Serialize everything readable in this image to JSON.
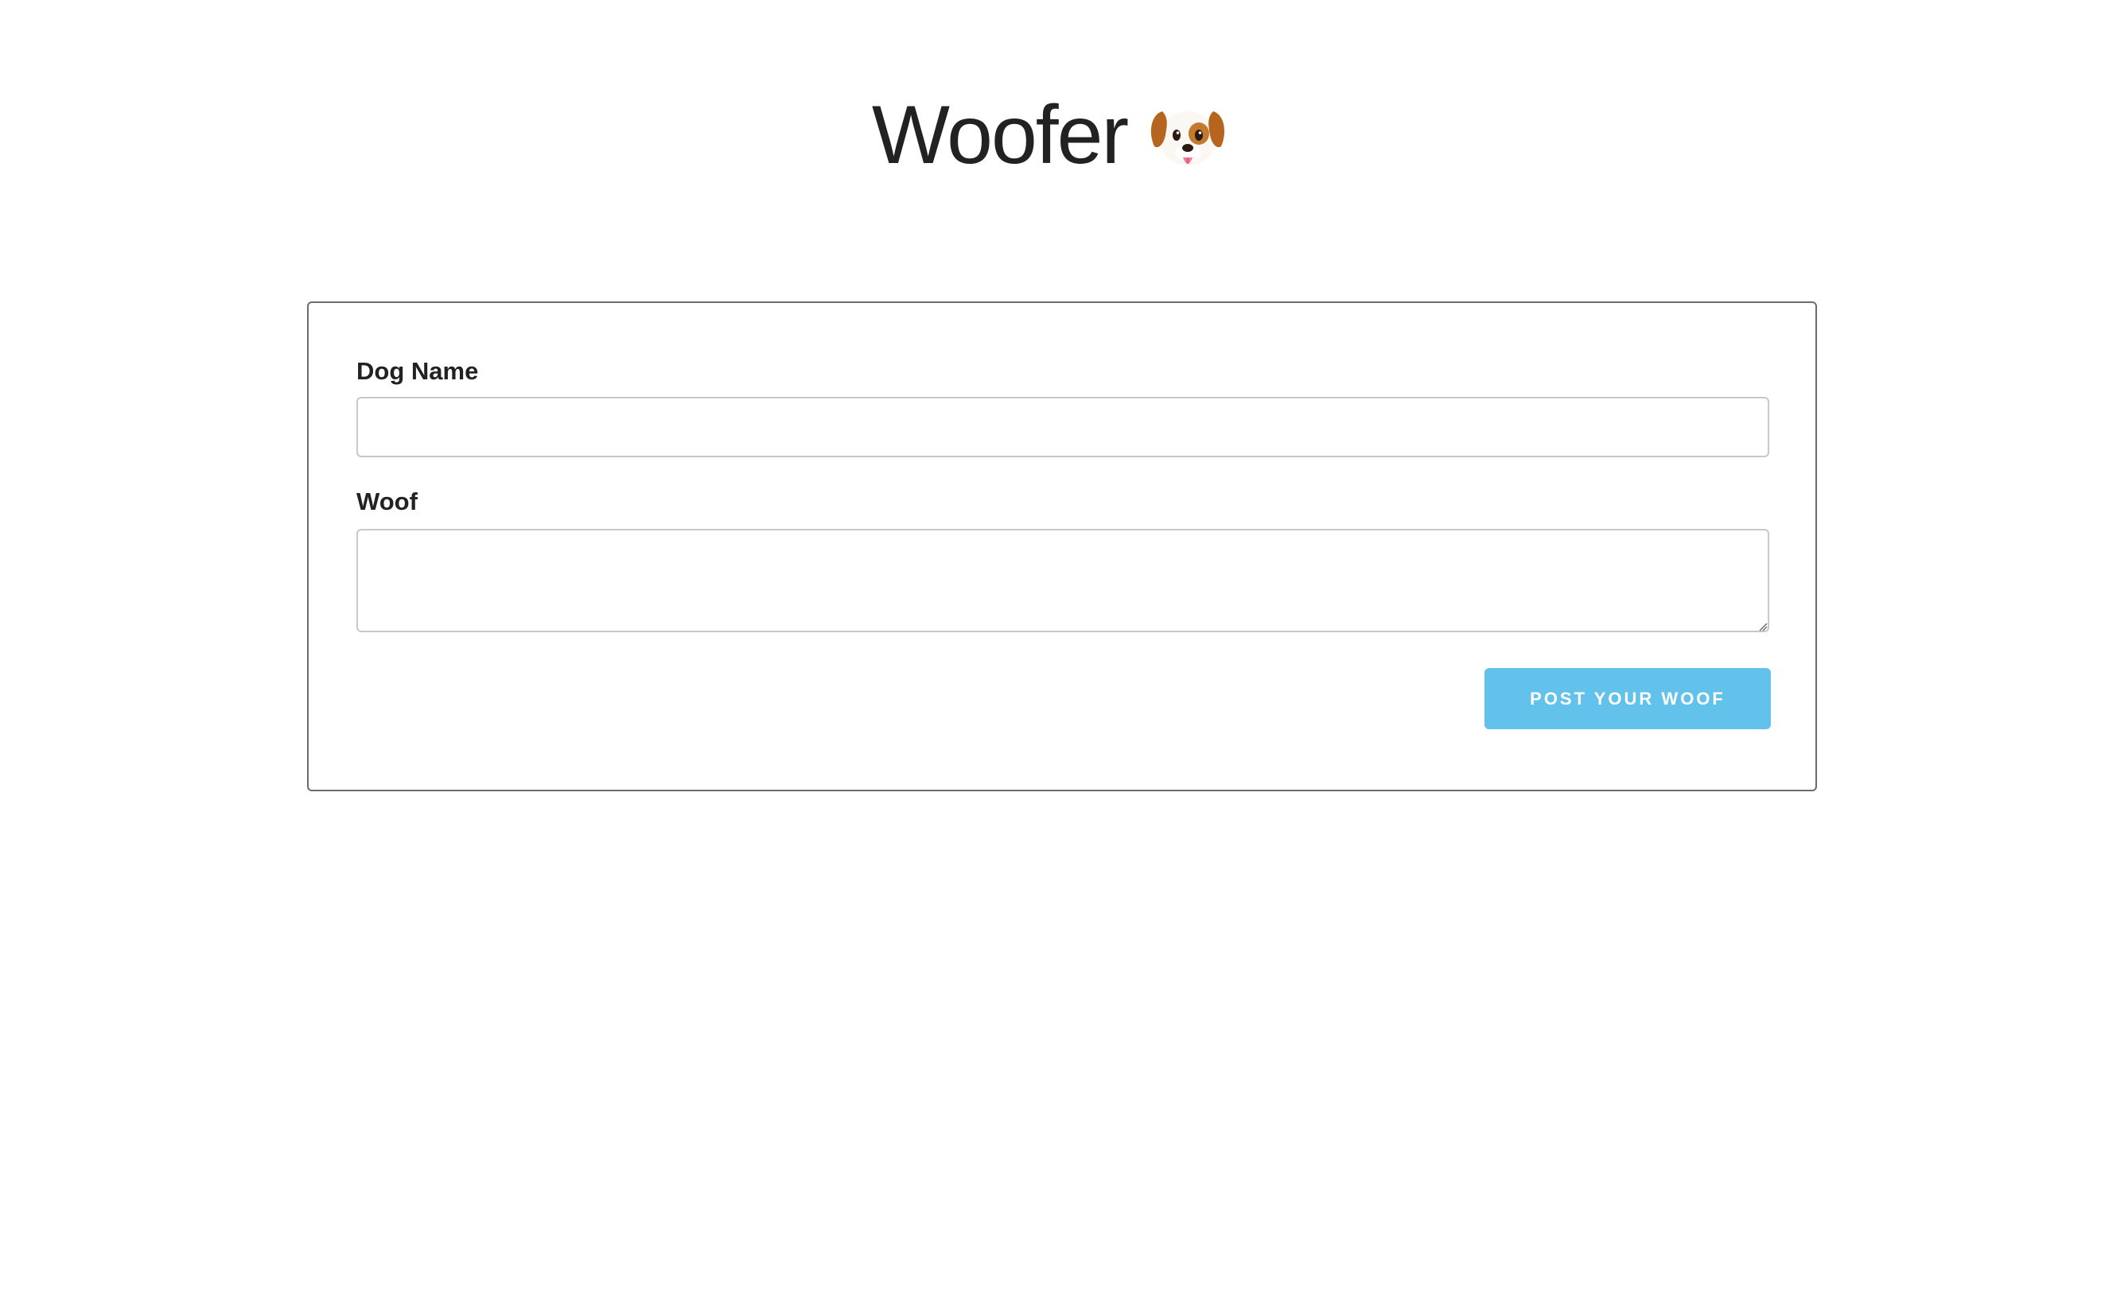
{
  "header": {
    "title": "Woofer",
    "logo_icon": "dog-face-emoji"
  },
  "form": {
    "dog_name_label": "Dog Name",
    "dog_name_value": "",
    "dog_name_placeholder": "",
    "woof_label": "Woof",
    "woof_value": "",
    "woof_placeholder": "",
    "submit_label": "POST YOUR WOOF"
  },
  "colors": {
    "button_background": "#63c2ec",
    "button_text": "#ffffff",
    "card_border": "#6b6b6b",
    "input_border": "#c8c8c8",
    "text": "#222222"
  }
}
